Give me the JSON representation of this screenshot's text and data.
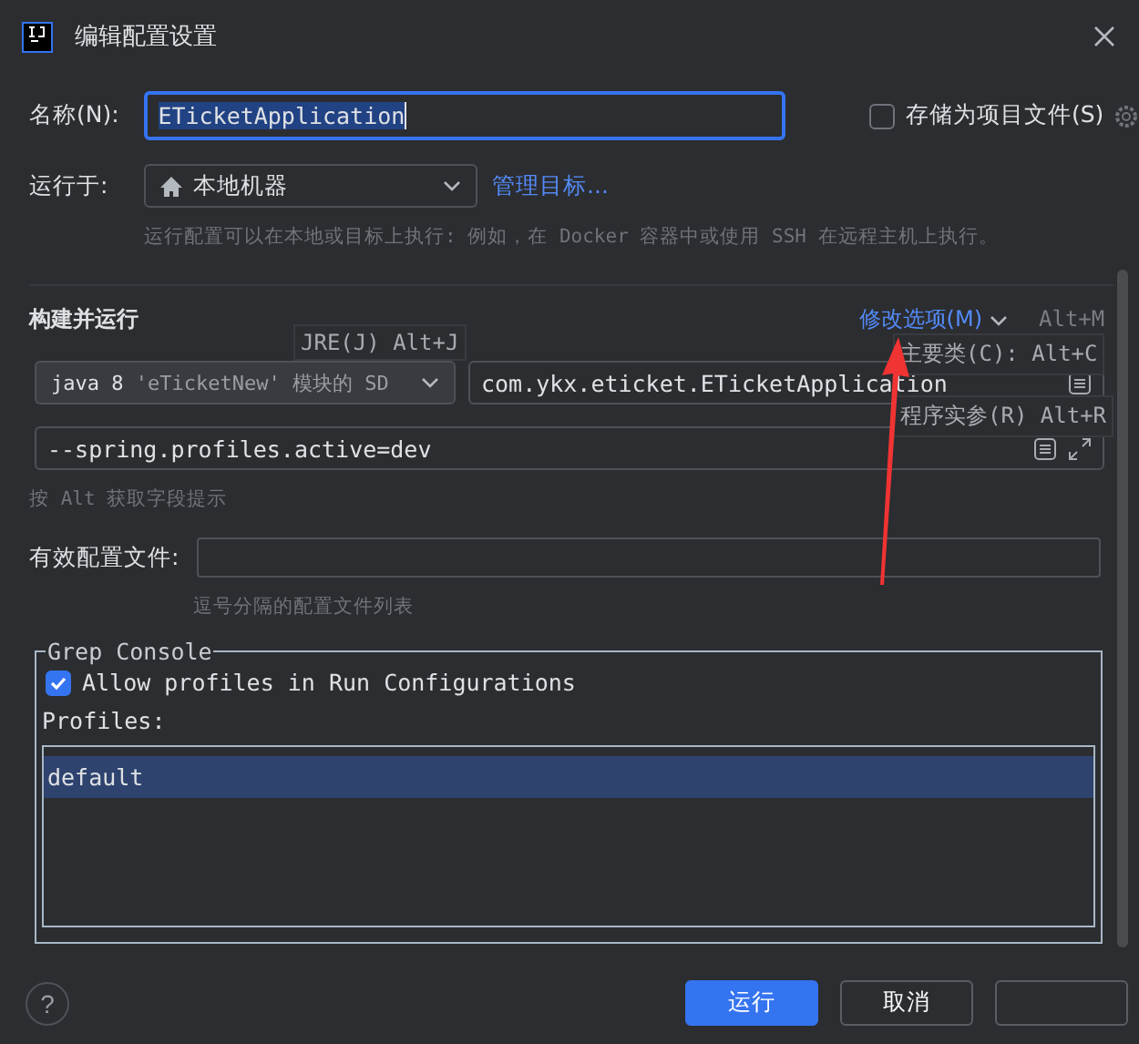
{
  "window": {
    "title": "编辑配置设置"
  },
  "name": {
    "label": "名称(N):",
    "value": "ETicketApplication"
  },
  "store_file": {
    "label": "存储为项目文件(S)",
    "checked": false
  },
  "run_on": {
    "label": "运行于:",
    "value": "本地机器",
    "link": "管理目标...",
    "hint": "运行配置可以在本地或目标上执行: 例如，在 Docker 容器中或使用 SSH 在远程主机上执行。"
  },
  "build_run": {
    "title": "构建并运行",
    "modify_options": "修改选项(M)",
    "jre_version": "java 8",
    "jre_detail": "'eTicketNew' 模块的 SD",
    "main_class": "com.ykx.eticket.ETicketApplication",
    "program_args": "--spring.profiles.active=dev",
    "alt_hint": "按 Alt 获取字段提示"
  },
  "shortcut_hints": [
    {
      "kind": "faded",
      "text": "Alt+M"
    },
    {
      "kind": "tooltip",
      "text": "JRE(J) Alt+J"
    },
    {
      "kind": "tooltip",
      "text": "主要类(C): Alt+C"
    },
    {
      "kind": "tooltip",
      "text": "程序实参(R) Alt+R"
    }
  ],
  "config_files": {
    "label": "有效配置文件:",
    "hint": "逗号分隔的配置文件列表"
  },
  "grep_console": {
    "title": "Grep Console",
    "allow_label": "Allow profiles in Run Configurations",
    "allow_checked": true,
    "profiles_label": "Profiles:",
    "profiles": [
      {
        "name": "default",
        "selected": true
      }
    ]
  },
  "buttons": [
    {
      "label": "运行",
      "kind": "primary"
    },
    {
      "label": "取消",
      "kind": "secondary"
    },
    {
      "kind": "hidden"
    }
  ],
  "help": "?"
}
